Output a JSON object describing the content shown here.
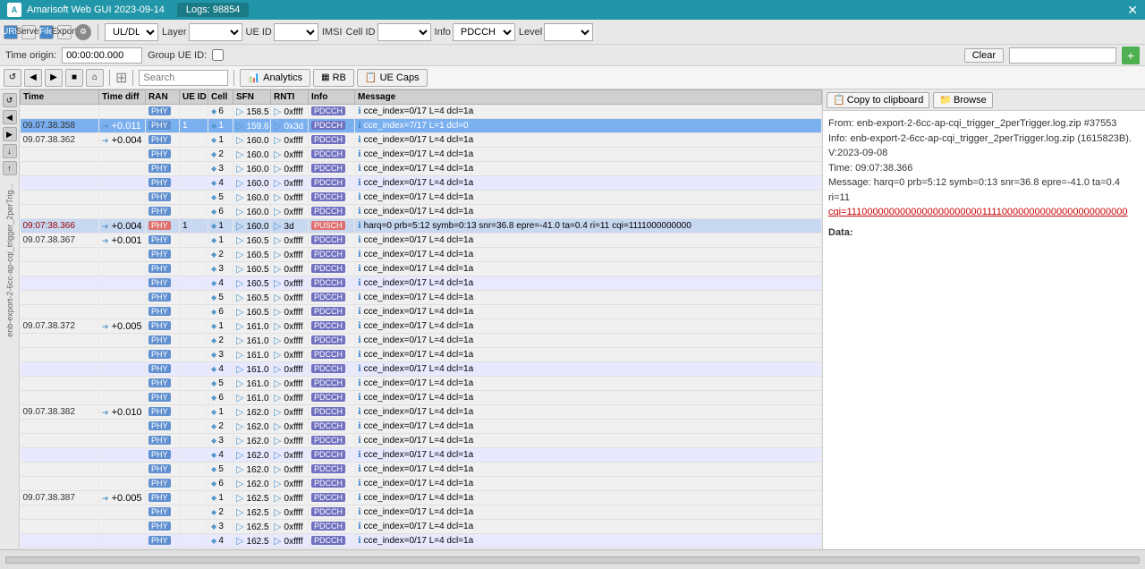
{
  "title_bar": {
    "app_name": "Amarisoft Web GUI 2023-09-14",
    "tab_label": "Logs: 98854",
    "close_label": "✕"
  },
  "toolbar1": {
    "mode_label": "UL/DL",
    "layer_label": "Layer",
    "ue_id_label": "UE ID",
    "imsi_label": "IMSI",
    "cell_id_label": "Cell ID",
    "info_label": "Info",
    "info_value": "PDCCH, P",
    "level_label": "Level"
  },
  "toolbar2": {
    "time_origin_label": "Time origin:",
    "time_value": "00:00:00.000",
    "group_ue_label": "Group UE ID:",
    "clear_label": "Clear",
    "add_label": "+"
  },
  "nav_toolbar": {
    "search_placeholder": "Search",
    "analytics_label": "Analytics",
    "rb_label": "RB",
    "ue_caps_label": "UE Caps"
  },
  "table": {
    "columns": [
      "Time",
      "Time diff",
      "RAN",
      "UE ID",
      "Cell",
      "SFN",
      "RNTI",
      "Info",
      "Message"
    ],
    "col_widths": [
      "90",
      "55",
      "35",
      "35",
      "30",
      "45",
      "45",
      "55",
      "350"
    ],
    "rows": [
      {
        "time": "",
        "time_diff": "",
        "ran": "PHY",
        "ue_id": "",
        "cell": "6",
        "sfn": "158.5",
        "rnti": "0xffff",
        "info": "PDCCH",
        "message": "cce_index=0/17 L=4 dcl=1a",
        "selected": false,
        "highlighted": false
      },
      {
        "time": "09.07.38.358",
        "time_diff": "+0.011",
        "ran": "PHY",
        "ue_id": "1",
        "cell": "1",
        "sfn": "159.6",
        "rnti": "0x3d",
        "info": "PDCCH",
        "message": "cce_index=7/17 L=1 dcl=0",
        "selected": false,
        "highlighted": true
      },
      {
        "time": "09.07.38.362",
        "time_diff": "+0.004",
        "ran": "PHY",
        "ue_id": "",
        "cell": "1",
        "sfn": "160.0",
        "rnti": "0xffff",
        "info": "PDCCH",
        "message": "cce_index=0/17 L=4 dcl=1a",
        "selected": false,
        "highlighted": false
      },
      {
        "time": "",
        "time_diff": "",
        "ran": "PHY",
        "ue_id": "",
        "cell": "2",
        "sfn": "160.0",
        "rnti": "0xffff",
        "info": "PDCCH",
        "message": "cce_index=0/17 L=4 dcl=1a",
        "selected": false,
        "highlighted": false
      },
      {
        "time": "",
        "time_diff": "",
        "ran": "PHY",
        "ue_id": "",
        "cell": "3",
        "sfn": "160.0",
        "rnti": "0xffff",
        "info": "PDCCH",
        "message": "cce_index=0/17 L=4 dcl=1a",
        "selected": false,
        "highlighted": false
      },
      {
        "time": "",
        "time_diff": "",
        "ran": "PHY",
        "ue_id": "",
        "cell": "4",
        "sfn": "160.0",
        "rnti": "0xffff",
        "info": "PDCCH",
        "message": "cce_index=0/17 L=4 dcl=1a",
        "selected": false,
        "highlighted": false,
        "row_highlight": true
      },
      {
        "time": "",
        "time_diff": "",
        "ran": "PHY",
        "ue_id": "",
        "cell": "5",
        "sfn": "160.0",
        "rnti": "0xffff",
        "info": "PDCCH",
        "message": "cce_index=0/17 L=4 dcl=1a",
        "selected": false,
        "highlighted": false
      },
      {
        "time": "",
        "time_diff": "",
        "ran": "PHY",
        "ue_id": "",
        "cell": "6",
        "sfn": "160.0",
        "rnti": "0xffff",
        "info": "PDCCH",
        "message": "cce_index=0/17 L=4 dcl=1a",
        "selected": false,
        "highlighted": false
      },
      {
        "time": "09:07:38.366",
        "time_diff": "+0.004",
        "ran": "PHY",
        "ue_id": "1",
        "cell": "1",
        "sfn": "160.0",
        "rnti": "3d",
        "info": "PUSCH",
        "message": "harq=0 prb=5:12 symb=0:13 snr=36.8 epre=-41.0 ta=0.4 ri=11 cqi=1111000000000",
        "selected": false,
        "highlighted": false,
        "is_pusch": true,
        "row_selected": true
      },
      {
        "time": "09.07.38.367",
        "time_diff": "+0.001",
        "ran": "PHY",
        "ue_id": "",
        "cell": "1",
        "sfn": "160.5",
        "rnti": "0xffff",
        "info": "PDCCH",
        "message": "cce_index=0/17 L=4 dcl=1a",
        "selected": false,
        "highlighted": false
      },
      {
        "time": "",
        "time_diff": "",
        "ran": "PHY",
        "ue_id": "",
        "cell": "2",
        "sfn": "160.5",
        "rnti": "0xffff",
        "info": "PDCCH",
        "message": "cce_index=0/17 L=4 dcl=1a",
        "selected": false,
        "highlighted": false
      },
      {
        "time": "",
        "time_diff": "",
        "ran": "PHY",
        "ue_id": "",
        "cell": "3",
        "sfn": "160.5",
        "rnti": "0xffff",
        "info": "PDCCH",
        "message": "cce_index=0/17 L=4 dcl=1a",
        "selected": false,
        "highlighted": false
      },
      {
        "time": "",
        "time_diff": "",
        "ran": "PHY",
        "ue_id": "",
        "cell": "4",
        "sfn": "160.5",
        "rnti": "0xffff",
        "info": "PDCCH",
        "message": "cce_index=0/17 L=4 dcl=1a",
        "selected": false,
        "highlighted": false,
        "row_highlight": true
      },
      {
        "time": "",
        "time_diff": "",
        "ran": "PHY",
        "ue_id": "",
        "cell": "5",
        "sfn": "160.5",
        "rnti": "0xffff",
        "info": "PDCCH",
        "message": "cce_index=0/17 L=4 dcl=1a",
        "selected": false,
        "highlighted": false
      },
      {
        "time": "",
        "time_diff": "",
        "ran": "PHY",
        "ue_id": "",
        "cell": "6",
        "sfn": "160.5",
        "rnti": "0xffff",
        "info": "PDCCH",
        "message": "cce_index=0/17 L=4 dcl=1a",
        "selected": false,
        "highlighted": false
      },
      {
        "time": "09.07.38.372",
        "time_diff": "+0.005",
        "ran": "PHY",
        "ue_id": "",
        "cell": "1",
        "sfn": "161.0",
        "rnti": "0xffff",
        "info": "PDCCH",
        "message": "cce_index=0/17 L=4 dcl=1a",
        "selected": false,
        "highlighted": false
      },
      {
        "time": "",
        "time_diff": "",
        "ran": "PHY",
        "ue_id": "",
        "cell": "2",
        "sfn": "161.0",
        "rnti": "0xffff",
        "info": "PDCCH",
        "message": "cce_index=0/17 L=4 dcl=1a",
        "selected": false,
        "highlighted": false
      },
      {
        "time": "",
        "time_diff": "",
        "ran": "PHY",
        "ue_id": "",
        "cell": "3",
        "sfn": "161.0",
        "rnti": "0xffff",
        "info": "PDCCH",
        "message": "cce_index=0/17 L=4 dcl=1a",
        "selected": false,
        "highlighted": false
      },
      {
        "time": "",
        "time_diff": "",
        "ran": "PHY",
        "ue_id": "",
        "cell": "4",
        "sfn": "161.0",
        "rnti": "0xffff",
        "info": "PDCCH",
        "message": "cce_index=0/17 L=4 dcl=1a",
        "selected": false,
        "highlighted": false,
        "row_highlight": true
      },
      {
        "time": "",
        "time_diff": "",
        "ran": "PHY",
        "ue_id": "",
        "cell": "5",
        "sfn": "161.0",
        "rnti": "0xffff",
        "info": "PDCCH",
        "message": "cce_index=0/17 L=4 dcl=1a",
        "selected": false,
        "highlighted": false
      },
      {
        "time": "",
        "time_diff": "",
        "ran": "PHY",
        "ue_id": "",
        "cell": "6",
        "sfn": "161.0",
        "rnti": "0xffff",
        "info": "PDCCH",
        "message": "cce_index=0/17 L=4 dcl=1a",
        "selected": false,
        "highlighted": false
      },
      {
        "time": "09.07.38.382",
        "time_diff": "+0.010",
        "ran": "PHY",
        "ue_id": "",
        "cell": "1",
        "sfn": "162.0",
        "rnti": "0xffff",
        "info": "PDCCH",
        "message": "cce_index=0/17 L=4 dcl=1a",
        "selected": false,
        "highlighted": false
      },
      {
        "time": "",
        "time_diff": "",
        "ran": "PHY",
        "ue_id": "",
        "cell": "2",
        "sfn": "162.0",
        "rnti": "0xffff",
        "info": "PDCCH",
        "message": "cce_index=0/17 L=4 dcl=1a",
        "selected": false,
        "highlighted": false
      },
      {
        "time": "",
        "time_diff": "",
        "ran": "PHY",
        "ue_id": "",
        "cell": "3",
        "sfn": "162.0",
        "rnti": "0xffff",
        "info": "PDCCH",
        "message": "cce_index=0/17 L=4 dcl=1a",
        "selected": false,
        "highlighted": false
      },
      {
        "time": "",
        "time_diff": "",
        "ran": "PHY",
        "ue_id": "",
        "cell": "4",
        "sfn": "162.0",
        "rnti": "0xffff",
        "info": "PDCCH",
        "message": "cce_index=0/17 L=4 dcl=1a",
        "selected": false,
        "highlighted": false,
        "row_highlight": true
      },
      {
        "time": "",
        "time_diff": "",
        "ran": "PHY",
        "ue_id": "",
        "cell": "5",
        "sfn": "162.0",
        "rnti": "0xffff",
        "info": "PDCCH",
        "message": "cce_index=0/17 L=4 dcl=1a",
        "selected": false,
        "highlighted": false
      },
      {
        "time": "",
        "time_diff": "",
        "ran": "PHY",
        "ue_id": "",
        "cell": "6",
        "sfn": "162.0",
        "rnti": "0xffff",
        "info": "PDCCH",
        "message": "cce_index=0/17 L=4 dcl=1a",
        "selected": false,
        "highlighted": false
      },
      {
        "time": "09.07.38.387",
        "time_diff": "+0.005",
        "ran": "PHY",
        "ue_id": "",
        "cell": "1",
        "sfn": "162.5",
        "rnti": "0xffff",
        "info": "PDCCH",
        "message": "cce_index=0/17 L=4 dcl=1a",
        "selected": false,
        "highlighted": false
      },
      {
        "time": "",
        "time_diff": "",
        "ran": "PHY",
        "ue_id": "",
        "cell": "2",
        "sfn": "162.5",
        "rnti": "0xffff",
        "info": "PDCCH",
        "message": "cce_index=0/17 L=4 dcl=1a",
        "selected": false,
        "highlighted": false
      },
      {
        "time": "",
        "time_diff": "",
        "ran": "PHY",
        "ue_id": "",
        "cell": "3",
        "sfn": "162.5",
        "rnti": "0xffff",
        "info": "PDCCH",
        "message": "cce_index=0/17 L=4 dcl=1a",
        "selected": false,
        "highlighted": false
      },
      {
        "time": "",
        "time_diff": "",
        "ran": "PHY",
        "ue_id": "",
        "cell": "4",
        "sfn": "162.5",
        "rnti": "0xffff",
        "info": "PDCCH",
        "message": "cce_index=0/17 L=4 dcl=1a",
        "selected": false,
        "highlighted": false,
        "row_highlight": true
      }
    ]
  },
  "right_panel": {
    "copy_btn_label": "Copy to clipboard",
    "browse_btn_label": "Browse",
    "content": {
      "from_line": "From: enb-export-2-6cc-ap-cqi_trigger_2perTrigger.log.zip #37553",
      "info_line": "Info: enb-export-2-6cc-ap-cqi_trigger_2perTrigger.log.zip (1615823B). V:2023-09-08",
      "time_line": "Time: 09:07:38.366",
      "message_line": "Message: harq=0 prb=5:12 symb=0:13 snr=36.8 epre=-41.0 ta=0.4 ri=11",
      "cqi_line": "cqi=1110000000000000000000000111100000000000000000000000",
      "data_label": "Data:"
    }
  },
  "status_bar": {
    "file_label": "enb-export-2-6cc-ap-cqi_trigger_2perTrig..."
  }
}
